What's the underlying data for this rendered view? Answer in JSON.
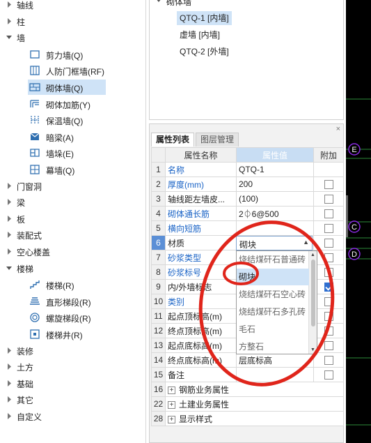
{
  "nav": {
    "items": [
      {
        "label": "轴线",
        "expanded": false
      },
      {
        "label": "柱",
        "expanded": false
      },
      {
        "label": "墙",
        "expanded": true
      },
      {
        "label": "门窗洞",
        "expanded": false
      },
      {
        "label": "梁",
        "expanded": false
      },
      {
        "label": "板",
        "expanded": false
      },
      {
        "label": "装配式",
        "expanded": false
      },
      {
        "label": "空心楼盖",
        "expanded": false
      },
      {
        "label": "楼梯",
        "expanded": true
      },
      {
        "label": "装修",
        "expanded": false
      },
      {
        "label": "土方",
        "expanded": false
      },
      {
        "label": "基础",
        "expanded": false
      },
      {
        "label": "其它",
        "expanded": false
      },
      {
        "label": "自定义",
        "expanded": false
      }
    ],
    "wall_children": [
      {
        "label": "剪力墙(Q)",
        "icon": "shear-wall-icon"
      },
      {
        "label": "人防门框墙(RF)",
        "icon": "civil-defense-door-wall-icon"
      },
      {
        "label": "砌体墙(Q)",
        "icon": "masonry-wall-icon",
        "selected": true
      },
      {
        "label": "砌体加筋(Y)",
        "icon": "masonry-reinforcement-icon"
      },
      {
        "label": "保温墙(Q)",
        "icon": "insulation-wall-icon"
      },
      {
        "label": "暗梁(A)",
        "icon": "hidden-beam-icon"
      },
      {
        "label": "墙垛(E)",
        "icon": "wall-pier-icon"
      },
      {
        "label": "幕墙(Q)",
        "icon": "curtain-wall-icon"
      }
    ],
    "stair_children": [
      {
        "label": "楼梯(R)",
        "icon": "stair-icon"
      },
      {
        "label": "直形梯段(R)",
        "icon": "straight-flight-icon"
      },
      {
        "label": "螺旋梯段(R)",
        "icon": "spiral-flight-icon"
      },
      {
        "label": "楼梯井(R)",
        "icon": "stairwell-icon"
      }
    ]
  },
  "components": {
    "group_label": "砌体墙",
    "items": [
      {
        "label": "QTQ-1 [内墙]",
        "selected": true
      },
      {
        "label": "虚墙 [内墙]",
        "selected": false
      },
      {
        "label": "QTQ-2 [外墙]",
        "selected": false
      }
    ]
  },
  "properties": {
    "close_glyph": "×",
    "tabs": [
      "属性列表",
      "图层管理"
    ],
    "active_tab": 0,
    "headers": {
      "name": "属性名称",
      "value": "属性值",
      "add": "附加"
    },
    "rows": [
      {
        "no": "1",
        "name": "名称",
        "value": "QTQ-1",
        "blue": true,
        "checkbox": false
      },
      {
        "no": "2",
        "name": "厚度(mm)",
        "value": "200",
        "blue": true,
        "checkbox": true,
        "checked": false
      },
      {
        "no": "3",
        "name": "轴线距左墙皮...",
        "value": "(100)",
        "blue": false,
        "checkbox": true,
        "checked": false
      },
      {
        "no": "4",
        "name": "砌体通长筋",
        "value": "2⏀6@500",
        "blue": true,
        "checkbox": true,
        "checked": false
      },
      {
        "no": "5",
        "name": "横向短筋",
        "value": "",
        "blue": true,
        "checkbox": true,
        "checked": false
      },
      {
        "no": "6",
        "name": "材质",
        "value": "",
        "blue": false,
        "checkbox": true,
        "checked": false,
        "current": true
      },
      {
        "no": "7",
        "name": "砂浆类型",
        "value": "",
        "blue": true,
        "checkbox": true,
        "checked": false
      },
      {
        "no": "8",
        "name": "砂浆标号",
        "value": "",
        "blue": true,
        "checkbox": true,
        "checked": false
      },
      {
        "no": "9",
        "name": "内/外墙标志",
        "value": "",
        "blue": false,
        "checkbox": true,
        "checked": true
      },
      {
        "no": "10",
        "name": "类别",
        "value": "",
        "blue": true,
        "checkbox": true,
        "checked": false
      },
      {
        "no": "11",
        "name": "起点顶标高(m)",
        "value": "",
        "blue": false,
        "checkbox": true,
        "checked": false
      },
      {
        "no": "12",
        "name": "终点顶标高(m)",
        "value": "",
        "blue": false,
        "checkbox": true,
        "checked": false
      },
      {
        "no": "13",
        "name": "起点底标高(m)",
        "value": "",
        "blue": false,
        "checkbox": true,
        "checked": false
      },
      {
        "no": "14",
        "name": "终点底标高(m)",
        "value": "层底标高",
        "blue": false,
        "checkbox": true,
        "checked": false
      },
      {
        "no": "15",
        "name": "备注",
        "value": "",
        "blue": false,
        "checkbox": true,
        "checked": false
      }
    ],
    "groups": [
      {
        "no": "16",
        "label": "钢筋业务属性"
      },
      {
        "no": "22",
        "label": "土建业务属性"
      },
      {
        "no": "28",
        "label": "显示样式"
      }
    ]
  },
  "dropdown": {
    "current_value": "砌块",
    "options": [
      "烧结煤矸石普通砖",
      "砌块",
      "烧结煤矸石空心砖",
      "烧结煤矸石多孔砖",
      "毛石",
      "方整石"
    ],
    "selected_index": 1
  },
  "canvas": {
    "axis_labels": [
      "E",
      "C",
      "D"
    ],
    "axis_label_color": "#8a2be2",
    "line_color": "#2e8b3a"
  },
  "annotation": {
    "color": "#e0251b"
  }
}
